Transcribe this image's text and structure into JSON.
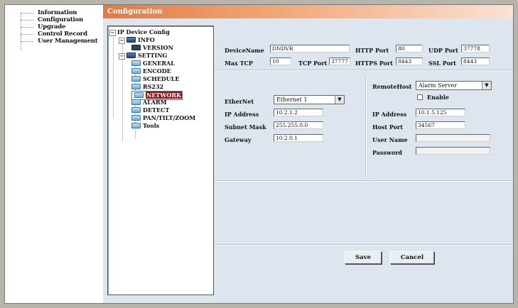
{
  "nav": {
    "items": [
      {
        "label": "Information"
      },
      {
        "label": "Configuration"
      },
      {
        "label": "Upgrade"
      },
      {
        "label": "Control Record"
      },
      {
        "label": "User Management"
      }
    ]
  },
  "title": "Configuration",
  "tree": {
    "root": "IP Device Config",
    "info": "INFO",
    "version": "VERSION",
    "setting": "SETTING",
    "children": [
      "GENERAL",
      "ENCODE",
      "SCHEDULE",
      "RS232",
      "NETWORK",
      "ALARM",
      "DETECT",
      "PAN/TILT/ZOOM",
      "Tools"
    ],
    "selected": "NETWORK"
  },
  "form": {
    "device_name_label": "DeviceName",
    "device_name_value": "DNDVR",
    "http_port_label": "HTTP Port",
    "http_port_value": "80",
    "udp_port_label": "UDP Port",
    "udp_port_value": "37778",
    "max_tcp_label": "Max TCP",
    "max_tcp_value": "10",
    "tcp_port_label": "TCP Port",
    "tcp_port_value": "37777",
    "https_port_label": "HTTPS Port",
    "https_port_value": "8443",
    "ssl_port_label": "SSL Port",
    "ssl_port_value": "8443",
    "ethernet_label": "EtherNet",
    "ethernet_value": "Ethernet 1",
    "ip_label": "IP Address",
    "ip_value": "10.2.1.2",
    "subnet_label": "Subnet Mask",
    "subnet_value": "255.255.0.0",
    "gateway_label": "Gateway",
    "gateway_value": "10.2.0.1",
    "remote_host_label": "RemoteHost",
    "remote_host_value": "Alarm Server",
    "enable_label": "Enable",
    "remote_ip_label": "IP Address",
    "remote_ip_value": "10.1.5.125",
    "host_port_label": "Host Port",
    "host_port_value": "34567",
    "user_name_label": "User Name",
    "user_name_value": "",
    "password_label": "Password",
    "password_value": ""
  },
  "buttons": {
    "save": "Save",
    "cancel": "Cancel"
  },
  "colors": {
    "title_bar_start": "#e07a45",
    "selected_node": "#8b1a1a",
    "panel_background": "#dde6ee"
  }
}
